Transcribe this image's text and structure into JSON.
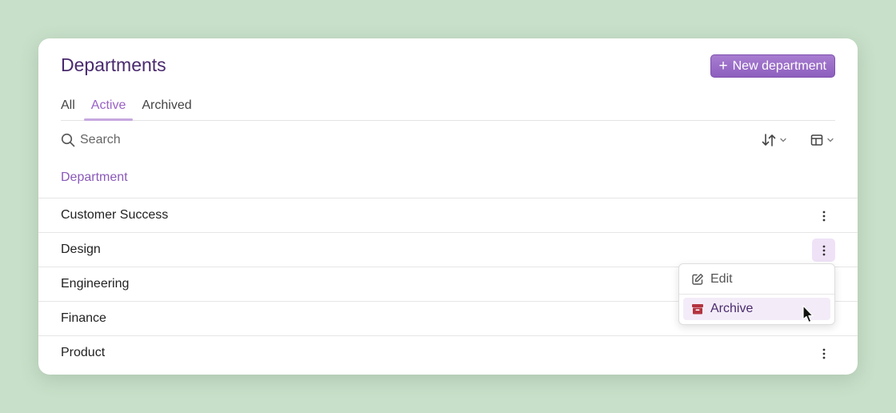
{
  "page": {
    "title": "Departments"
  },
  "actions": {
    "new_department_label": "New department"
  },
  "tabs": [
    {
      "label": "All",
      "active": false
    },
    {
      "label": "Active",
      "active": true
    },
    {
      "label": "Archived",
      "active": false
    }
  ],
  "search": {
    "placeholder": "Search",
    "value": ""
  },
  "toolbar": {
    "sort_icon": "sort-icon",
    "columns_icon": "columns-layout-icon"
  },
  "table": {
    "column_header": "Department",
    "rows": [
      {
        "name": "Customer Success"
      },
      {
        "name": "Design"
      },
      {
        "name": "Engineering"
      },
      {
        "name": "Finance"
      },
      {
        "name": "Product"
      }
    ]
  },
  "row_menu": {
    "items": [
      {
        "label": "Edit",
        "icon": "edit-icon"
      },
      {
        "label": "Archive",
        "icon": "archive-icon"
      }
    ]
  },
  "colors": {
    "accent": "#9a62c6",
    "title": "#4a2a6e",
    "archive_icon": "#b3343f",
    "background": "#c8e0c9"
  }
}
